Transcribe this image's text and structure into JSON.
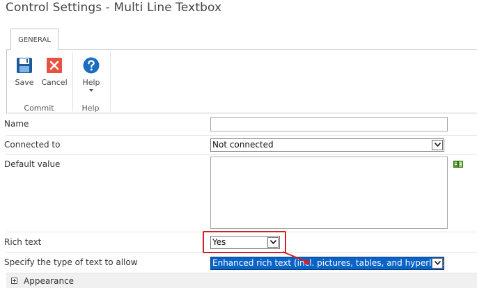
{
  "dialog": {
    "title": "Control Settings - Multi Line Textbox"
  },
  "ribbon": {
    "tab": "GENERAL",
    "groups": [
      {
        "label": "Commit",
        "buttons": [
          {
            "label": "Save",
            "icon": "floppy-disk-icon"
          },
          {
            "label": "Cancel",
            "icon": "close-icon"
          }
        ]
      },
      {
        "label": "Help",
        "buttons": [
          {
            "label": "Help",
            "icon": "help-icon"
          }
        ]
      }
    ]
  },
  "form": {
    "name": {
      "label": "Name",
      "value": ""
    },
    "connected_to": {
      "label": "Connected to",
      "value": "Not connected"
    },
    "default_value": {
      "label": "Default value",
      "value": "",
      "icon": "formula-builder-icon"
    },
    "rich_text": {
      "label": "Rich text",
      "value": "Yes"
    },
    "text_type": {
      "label": "Specify the type of text to allow",
      "value": "Enhanced rich text (incl. pictures, tables, and hyperlinks)"
    }
  },
  "sections": {
    "appearance": "Appearance"
  },
  "colors": {
    "accent": "#0078d7",
    "selection": "#0a64c8",
    "annotation": "#d0202a"
  }
}
